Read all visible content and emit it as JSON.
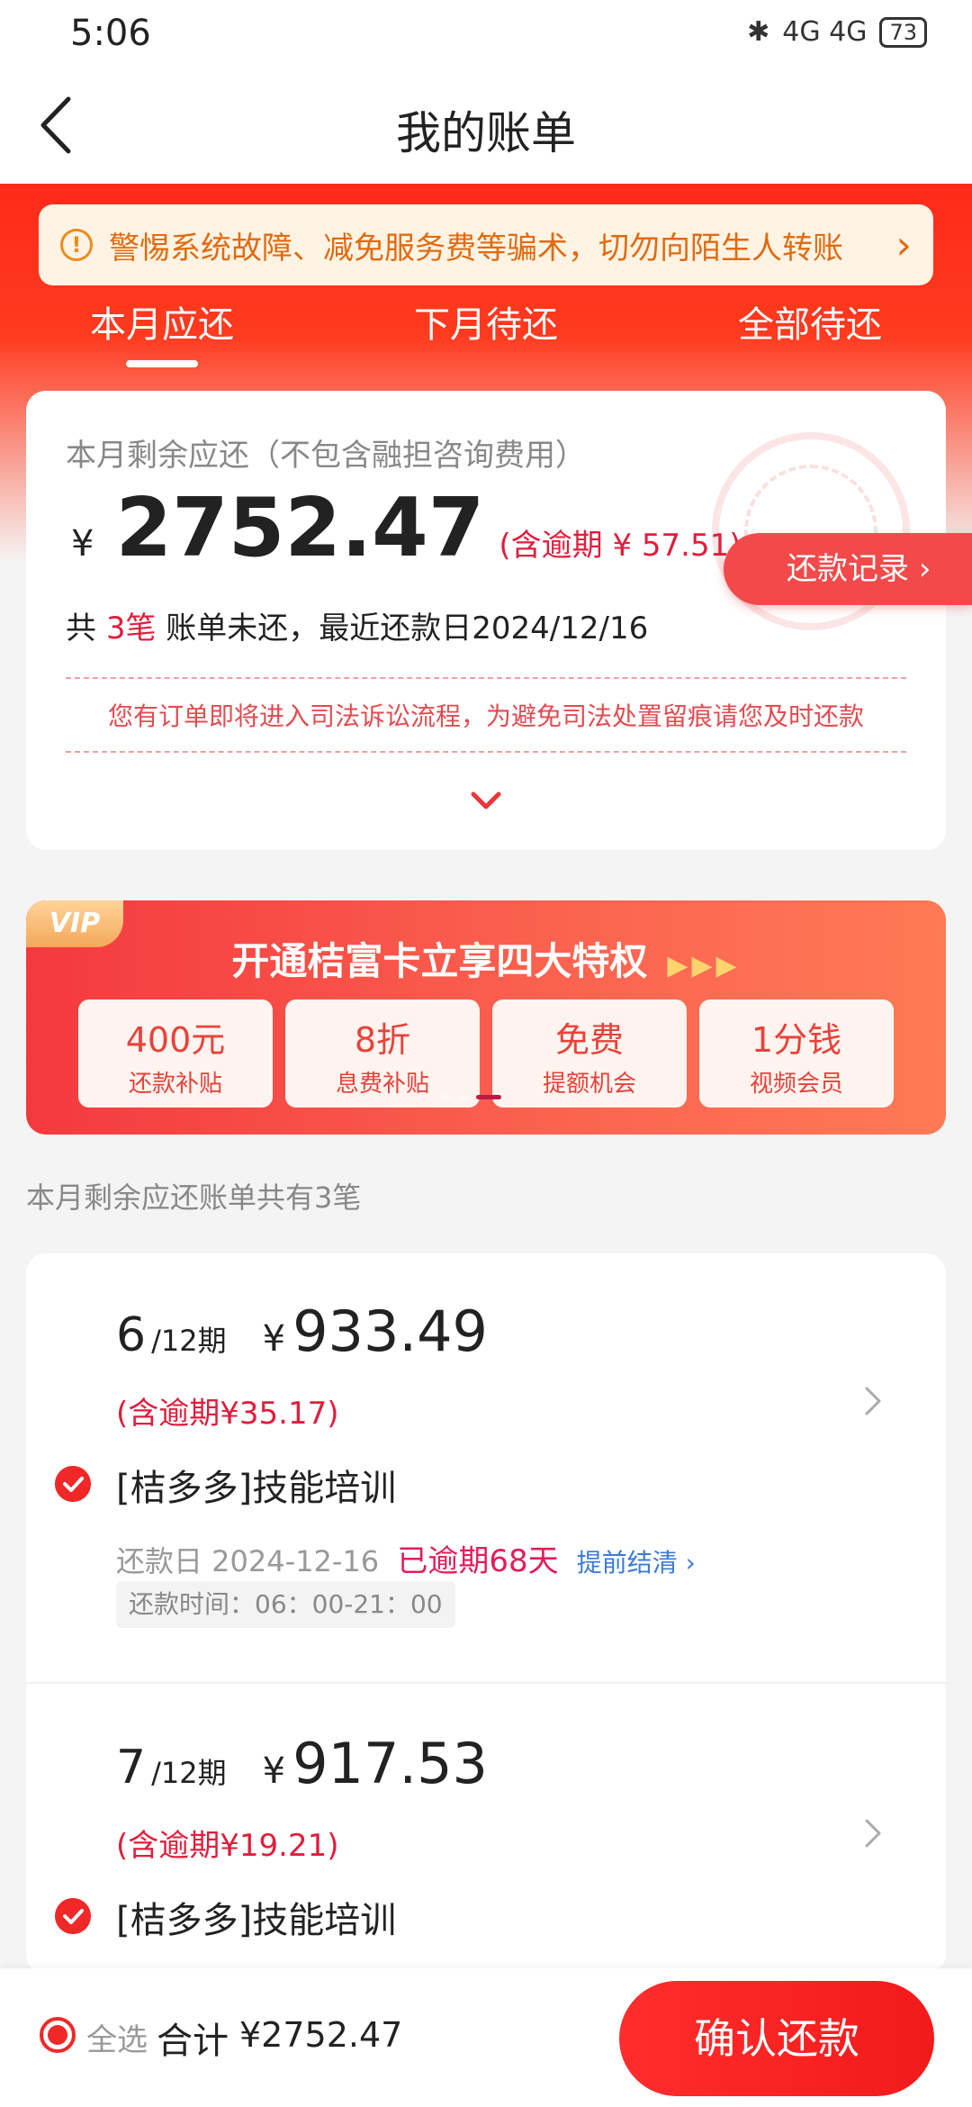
{
  "status_bar": {
    "time": "5:06",
    "network": "4G  4G",
    "battery": "73"
  },
  "nav": {
    "title": "我的账单"
  },
  "notice": {
    "text": "警惕系统故障、减免服务费等骗术，切勿向陌生人转账"
  },
  "tabs": [
    {
      "label": "本月应还",
      "active": true
    },
    {
      "label": "下月待还",
      "active": false
    },
    {
      "label": "全部待还",
      "active": false
    }
  ],
  "summary": {
    "label": "本月剩余应还（不包含融担咨询费用）",
    "currency": "¥",
    "amount": "2752.47",
    "overdue": "(含逾期 ¥ 57.51)",
    "detail_prefix": "共 ",
    "count": "3笔",
    "detail_suffix": " 账单未还，最近还款日2024/12/16",
    "legal_notice": "您有订单即将进入司法诉讼流程，为避免司法处置留痕请您及时还款",
    "record_button": "还款记录"
  },
  "vip": {
    "badge": "VIP",
    "title": "开通桔富卡立享四大特权",
    "perks": [
      {
        "main": "400元",
        "sub": "还款补贴"
      },
      {
        "main": "8折",
        "sub": "息费补贴"
      },
      {
        "main": "免费",
        "sub": "提额机会"
      },
      {
        "main": "1分钱",
        "sub": "视频会员"
      }
    ]
  },
  "list_caption": "本月剩余应还账单共有3笔",
  "bills": [
    {
      "period_num": "6",
      "period_total": "/12期",
      "currency": "¥",
      "amount": "933.49",
      "overdue": "(含逾期¥35.17)",
      "name": "[桔多多]技能培训",
      "due_label": "还款日 2024-12-16",
      "late": "已逾期68天",
      "early": "提前结清",
      "time": "还款时间：06：00-21：00",
      "checked": true
    },
    {
      "period_num": "7",
      "period_total": "/12期",
      "currency": "¥",
      "amount": "917.53",
      "overdue": "(含逾期¥19.21)",
      "name": "[桔多多]技能培训",
      "checked": true
    }
  ],
  "bottom": {
    "select_all": "全选",
    "total_label": "合计",
    "total_amount": "¥2752.47",
    "confirm": "确认还款"
  },
  "colors": {
    "brand_red": "#f02828",
    "overdue": "#e11d3c",
    "link_blue": "#3b7ad8"
  }
}
